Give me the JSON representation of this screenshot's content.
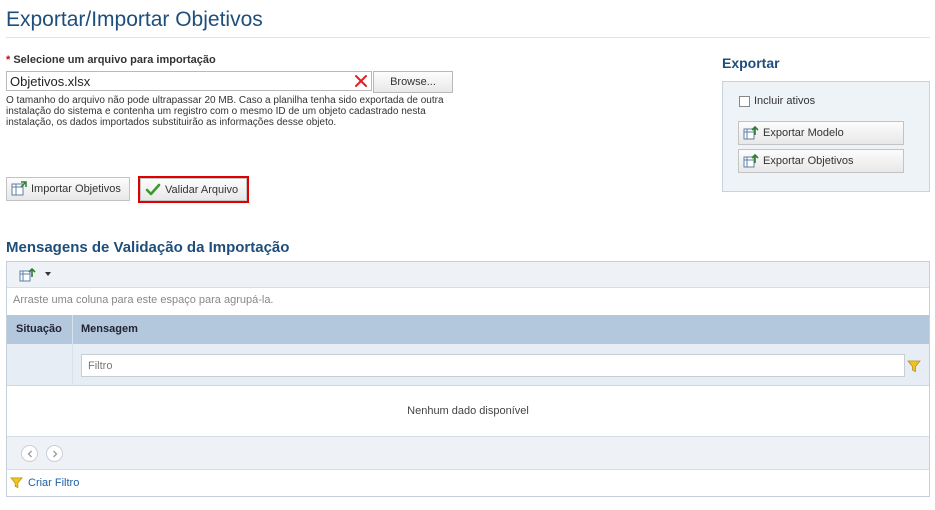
{
  "page": {
    "title": "Exportar/Importar Objetivos"
  },
  "import": {
    "required_marker": "*",
    "file_label": "Selecione um arquivo para importação",
    "file_value": "Objetivos.xlsx",
    "browse_label": "Browse...",
    "note": "O tamanho do arquivo não pode ultrapassar 20 MB. Caso a planilha tenha sido exportada de outra instalação do sistema e contenha um registro com o mesmo ID de um objeto cadastrado nesta instalação, os dados importados substituirão as informações desse objeto.",
    "import_button": "Importar Objetivos",
    "validate_button": "Validar Arquivo"
  },
  "export": {
    "title": "Exportar",
    "include_active_label": "Incluir ativos",
    "include_active_checked": false,
    "export_template_button": "Exportar Modelo",
    "export_objectives_button": "Exportar Objetivos"
  },
  "validation": {
    "title": "Mensagens de Validação da Importação",
    "group_hint": "Arraste uma coluna para este espaço para agrupá-la.",
    "columns": [
      "Situação",
      "Mensagem"
    ],
    "filter_placeholder": "Filtro",
    "empty_text": "Nenhum dado disponível",
    "create_filter_label": "Criar Filtro"
  },
  "colors": {
    "title": "#1f4e7a",
    "header_bg": "#b3c8dc",
    "highlight": "#e00000",
    "link": "#1f5fa8"
  }
}
